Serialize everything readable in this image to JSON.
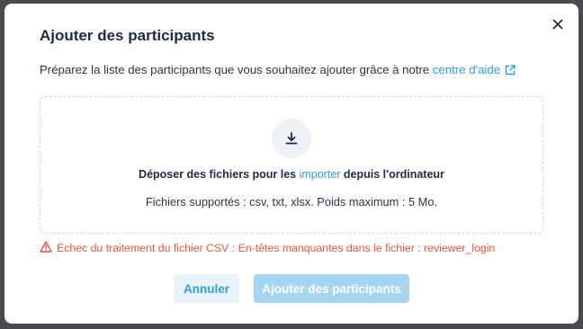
{
  "dialog": {
    "title": "Ajouter des participants",
    "intro_text": "Préparez la liste des participants que vous souhaitez ajouter grâce à notre ",
    "help_link": "centre d'aide"
  },
  "dropzone": {
    "text_before": "Déposer des fichiers pour les ",
    "import_link": "importer",
    "text_after": " depuis l'ordinateur",
    "supported": "Fichiers supportés : csv, txt, xlsx. Poids maximum : 5 Mo."
  },
  "error": {
    "message": "Échec du traitement du fichier CSV : En-têtes manquantes dans le fichier : reviewer_login"
  },
  "buttons": {
    "cancel": "Annuler",
    "add": "Ajouter des participants"
  },
  "colors": {
    "accent": "#2f9fd8",
    "error": "#e8553f",
    "primary_disabled": "#a5d5f1"
  }
}
